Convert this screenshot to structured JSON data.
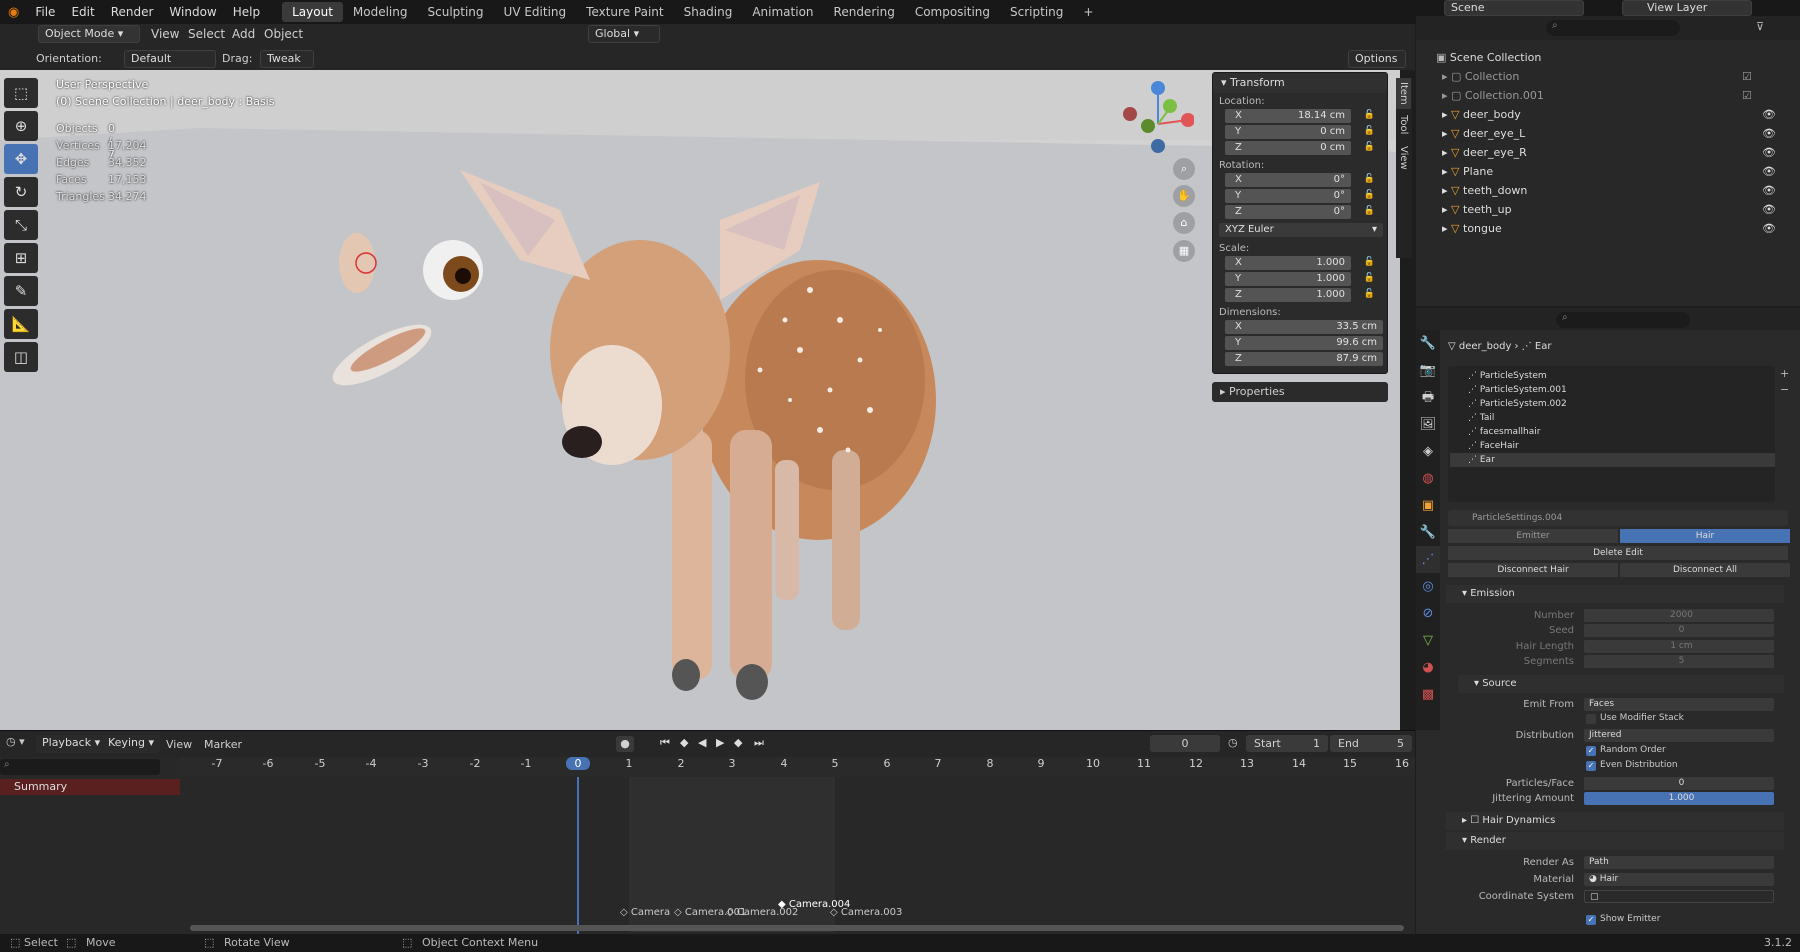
{
  "menu": [
    "File",
    "Edit",
    "Render",
    "Window",
    "Help"
  ],
  "workspaces": [
    "Layout",
    "Modeling",
    "Sculpting",
    "UV Editing",
    "Texture Paint",
    "Shading",
    "Animation",
    "Rendering",
    "Compositing",
    "Scripting"
  ],
  "active_workspace": "Layout",
  "top_right": {
    "scene": "Scene",
    "view_layer": "View Layer"
  },
  "header": {
    "mode": "Object Mode",
    "menus": [
      "View",
      "Select",
      "Add",
      "Object"
    ],
    "orientation_label": "Orientation:",
    "orientation_value": "Default",
    "drag_label": "Drag:",
    "drag_value": "Tweak",
    "transform_space": "Global",
    "options": "Options"
  },
  "viewport": {
    "title": "User Perspective",
    "subtitle": "(0) Scene Collection | deer_body : Basis",
    "stats": [
      {
        "k": "Objects",
        "v": "0 / 7"
      },
      {
        "k": "Vertices",
        "v": "17,204"
      },
      {
        "k": "Edges",
        "v": "34,352"
      },
      {
        "k": "Faces",
        "v": "17,153"
      },
      {
        "k": "Triangles",
        "v": "34,274"
      }
    ],
    "side_tabs": [
      "Item",
      "Tool",
      "View"
    ]
  },
  "transform": {
    "title": "Transform",
    "location_label": "Location:",
    "location": [
      {
        "a": "X",
        "v": "18.14 cm"
      },
      {
        "a": "Y",
        "v": "0 cm"
      },
      {
        "a": "Z",
        "v": "0 cm"
      }
    ],
    "rotation_label": "Rotation:",
    "rotation": [
      {
        "a": "X",
        "v": "0°"
      },
      {
        "a": "Y",
        "v": "0°"
      },
      {
        "a": "Z",
        "v": "0°"
      }
    ],
    "rotation_mode": "XYZ Euler",
    "scale_label": "Scale:",
    "scale": [
      {
        "a": "X",
        "v": "1.000"
      },
      {
        "a": "Y",
        "v": "1.000"
      },
      {
        "a": "Z",
        "v": "1.000"
      }
    ],
    "dimensions_label": "Dimensions:",
    "dimensions": [
      {
        "a": "X",
        "v": "33.5 cm"
      },
      {
        "a": "Y",
        "v": "99.6 cm"
      },
      {
        "a": "Z",
        "v": "87.9 cm"
      }
    ],
    "properties": "Properties"
  },
  "outliner": {
    "root": "Scene Collection",
    "items": [
      "Collection",
      "Collection.001",
      "deer_body",
      "deer_eye_L",
      "deer_eye_R",
      "Plane",
      "teeth_down",
      "teeth_up",
      "tongue"
    ]
  },
  "properties": {
    "breadcrumb": [
      "deer_body",
      "Ear"
    ],
    "systems": [
      "ParticleSystem",
      "ParticleSystem.001",
      "ParticleSystem.002",
      "Tail",
      "facesmallhair",
      "FaceHair",
      "Ear"
    ],
    "settings": "ParticleSettings.004",
    "type_tabs": [
      "Emitter",
      "Hair"
    ],
    "delete_edit": "Delete Edit",
    "disconnect_hair": "Disconnect Hair",
    "disconnect_all": "Disconnect All",
    "emission": "Emission",
    "emission_fields": [
      {
        "k": "Number",
        "v": "2000"
      },
      {
        "k": "Seed",
        "v": "0"
      },
      {
        "k": "Hair Length",
        "v": "1 cm"
      },
      {
        "k": "Segments",
        "v": "5"
      }
    ],
    "source": "Source",
    "emit_from_label": "Emit From",
    "emit_from": "Faces",
    "use_modifier_stack": "Use Modifier Stack",
    "distribution_label": "Distribution",
    "distribution": "Jittered",
    "random_order": "Random Order",
    "even_distribution": "Even Distribution",
    "particles_face_label": "Particles/Face",
    "particles_face": "0",
    "jittering_label": "Jittering Amount",
    "jittering": "1.000",
    "hair_dynamics": "Hair Dynamics",
    "render": "Render",
    "render_as_label": "Render As",
    "render_as": "Path",
    "material_label": "Material",
    "material": "Hair",
    "coord_label": "Coordinate System",
    "show_emitter": "Show Emitter"
  },
  "timeline": {
    "menus": [
      "Playback",
      "Keying",
      "View",
      "Marker"
    ],
    "frame": "0",
    "start_label": "Start",
    "start": "1",
    "end_label": "End",
    "end": "5",
    "current": "0",
    "summary": "Summary",
    "ticks": [
      "-7",
      "-6",
      "-5",
      "-4",
      "-3",
      "-2",
      "-1",
      "0",
      "1",
      "2",
      "3",
      "4",
      "5",
      "6",
      "7",
      "8",
      "9",
      "10",
      "11",
      "12",
      "13",
      "14",
      "15",
      "16"
    ],
    "markers": [
      "Camera",
      "Camera.001",
      "Camera.002",
      "Camera.004",
      "Camera.003"
    ]
  },
  "status": {
    "select": "Select",
    "move": "Move",
    "rotate": "Rotate View",
    "context": "Object Context Menu",
    "version": "3.1.2"
  }
}
